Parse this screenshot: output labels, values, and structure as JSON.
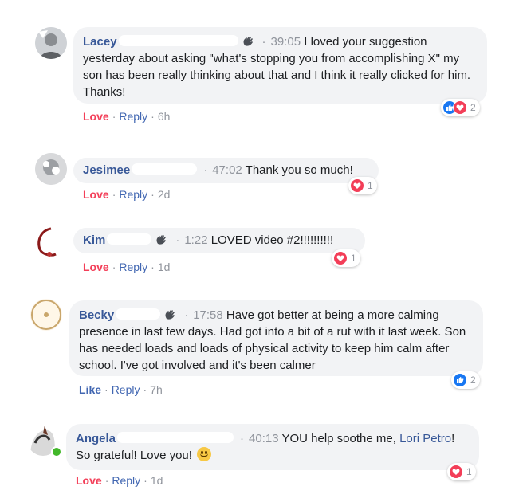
{
  "comments": [
    {
      "name": "Lacey",
      "timestamp": "39:05",
      "text": "I loved your suggestion yesterday about asking \"what's stopping you from accomplishing X\" my son has been really thinking about that and I think it really clicked for him. Thanks!",
      "reaction_label": "Love",
      "reply_label": "Reply",
      "age": "6h",
      "reaction_count": "2"
    },
    {
      "name": "Jesimee",
      "timestamp": "47:02",
      "text": "Thank you so much!",
      "reaction_label": "Love",
      "reply_label": "Reply",
      "age": "2d",
      "reaction_count": "1"
    },
    {
      "name": "Kim",
      "timestamp": "1:22",
      "text": "LOVED video #2!!!!!!!!!!",
      "reaction_label": "Love",
      "reply_label": "Reply",
      "age": "1d",
      "reaction_count": "1"
    },
    {
      "name": "Becky",
      "timestamp": "17:58",
      "text": "Have got better at being a more calming presence in last few days. Had got into a bit of a rut with it last week. Son has needed loads and loads of physical activity to keep him calm after school. I've got involved and it's been calmer",
      "reaction_label": "Like",
      "reply_label": "Reply",
      "age": "7h",
      "reaction_count": "2"
    },
    {
      "name": "Angela",
      "timestamp": "40:13",
      "text_before": "YOU help soothe me,",
      "mention": "Lori Petro",
      "text_after": "! So grateful! Love you!",
      "reaction_label": "Love",
      "reply_label": "Reply",
      "age": "1d",
      "reaction_count": "1"
    }
  ],
  "icons": {
    "wave": "waving-hand-icon",
    "like": "like-reaction-icon",
    "love": "love-reaction-icon",
    "emoji": "smiling-face-emoji"
  },
  "colors": {
    "name": "#385898",
    "love": "#f33e58",
    "like": "#4267b2",
    "bubble": "#f2f3f5",
    "meta": "#90949c"
  }
}
